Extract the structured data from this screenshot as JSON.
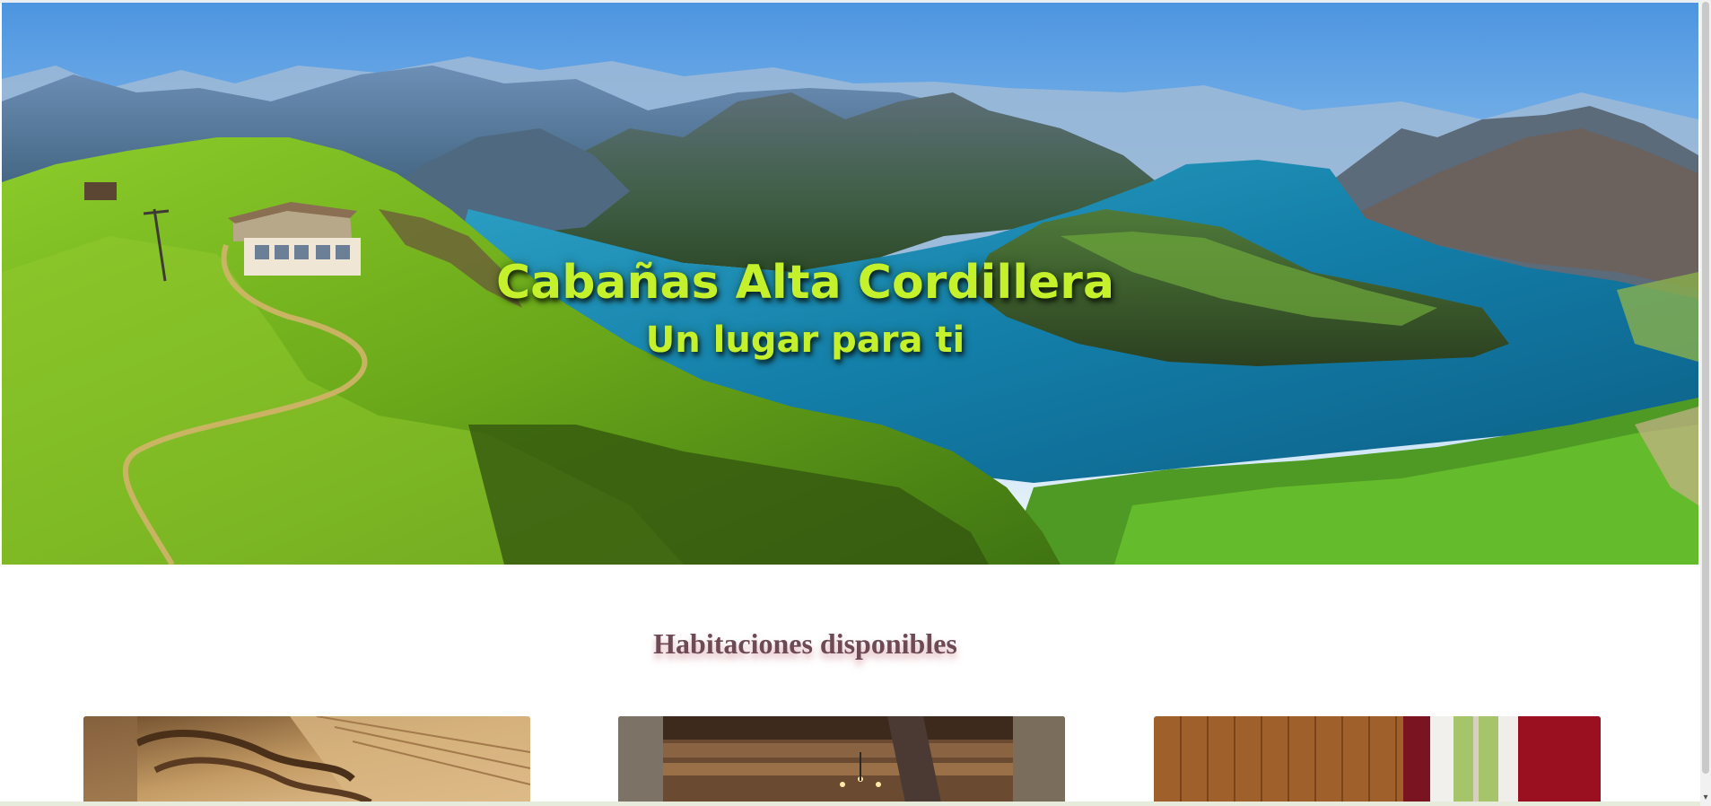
{
  "hero": {
    "title": "Cabañas Alta Cordillera",
    "subtitle": "Un lugar para ti"
  },
  "rooms": {
    "heading": "Habitaciones disponibles",
    "cards": [
      {
        "image": "room-wooden-bunk-photo"
      },
      {
        "image": "room-rustic-beams-chandelier-photo"
      },
      {
        "image": "room-wood-panel-window-photo"
      }
    ]
  },
  "colors": {
    "hero_text": "#c4f02c",
    "heading_text": "#6e4a56",
    "lake": "#1a7398",
    "grass": "#6ab21f"
  },
  "icons": {
    "scroll_down": "▾"
  }
}
